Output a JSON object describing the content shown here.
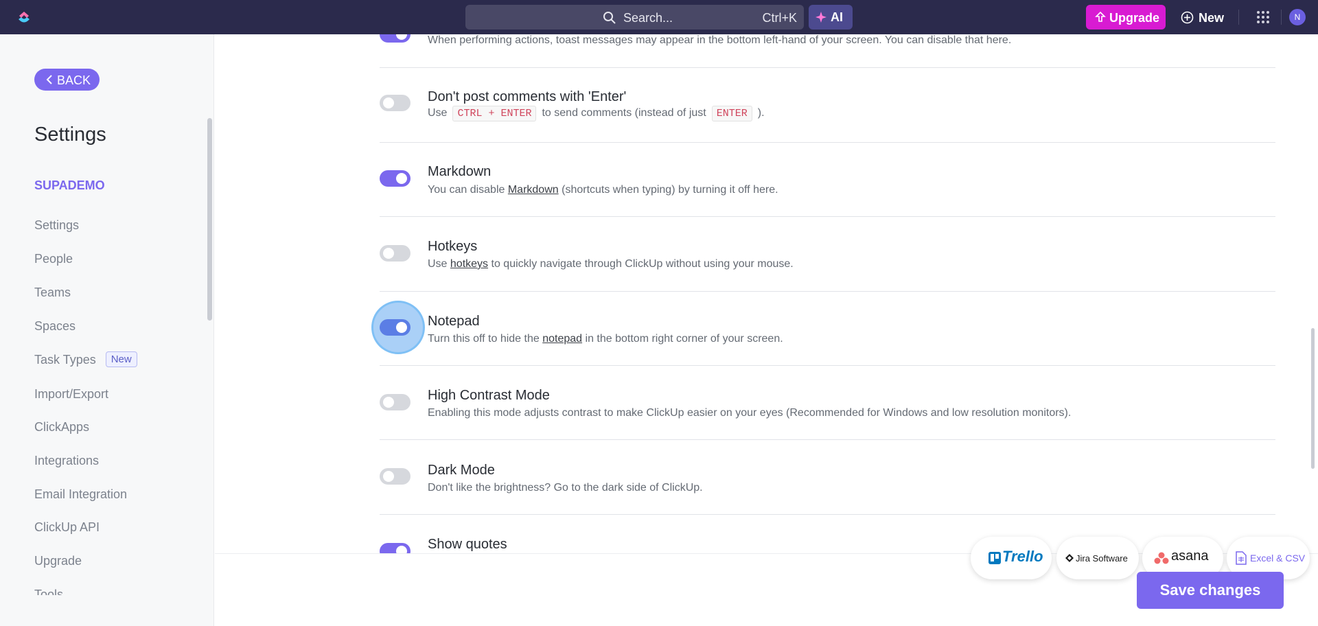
{
  "topbar": {
    "search_placeholder": "Search...",
    "search_shortcut": "Ctrl+K",
    "ai_label": "AI",
    "upgrade_label": "Upgrade",
    "new_label": "New",
    "avatar_initial": "N"
  },
  "sidebar": {
    "back_label": "BACK",
    "title": "Settings",
    "workspace": "SUPADEMO",
    "items": [
      {
        "label": "Settings"
      },
      {
        "label": "People"
      },
      {
        "label": "Teams"
      },
      {
        "label": "Spaces"
      },
      {
        "label": "Task Types",
        "badge": "New"
      },
      {
        "label": "Import/Export"
      },
      {
        "label": "ClickApps"
      },
      {
        "label": "Integrations"
      },
      {
        "label": "Email Integration"
      },
      {
        "label": "ClickUp API"
      },
      {
        "label": "Upgrade"
      },
      {
        "label": "Tools"
      }
    ]
  },
  "settings": {
    "toast": {
      "desc": "When performing actions, toast messages may appear in the bottom left-hand of your screen. You can disable that here.",
      "enabled": true
    },
    "enter_comments": {
      "title": "Don't post comments with 'Enter'",
      "desc_prefix": "Use",
      "kbd1": "CTRL + ENTER",
      "desc_mid": "to send comments (instead of just",
      "kbd2": "ENTER",
      "desc_suffix": ").",
      "enabled": false
    },
    "markdown": {
      "title": "Markdown",
      "desc_prefix": "You can disable",
      "link": "Markdown",
      "desc_suffix": "(shortcuts when typing) by turning it off here.",
      "enabled": true
    },
    "hotkeys": {
      "title": "Hotkeys",
      "desc_prefix": "Use",
      "link": "hotkeys",
      "desc_suffix": "to quickly navigate through ClickUp without using your mouse.",
      "enabled": false
    },
    "notepad": {
      "title": "Notepad",
      "desc_prefix": "Turn this off to hide the",
      "link": "notepad",
      "desc_suffix": "in the bottom right corner of your screen.",
      "enabled": true
    },
    "high_contrast": {
      "title": "High Contrast Mode",
      "desc": "Enabling this mode adjusts contrast to make ClickUp easier on your eyes (Recommended for Windows and low resolution monitors).",
      "enabled": false
    },
    "dark_mode": {
      "title": "Dark Mode",
      "desc": "Don't like the brightness? Go to the dark side of ClickUp.",
      "enabled": false
    },
    "show_quotes": {
      "title": "Show quotes",
      "enabled": true
    }
  },
  "import_chips": {
    "trello": "Trello",
    "jira": "Jira Software",
    "asana": "asana",
    "excel": "Excel & CSV"
  },
  "footer": {
    "save_label": "Save changes"
  },
  "colors": {
    "accent": "#7b68ee",
    "topbar": "#2b2a4c",
    "upgrade": "#d81bd2"
  },
  "icons": [
    "clickup-logo-icon",
    "search-icon",
    "ai-sparkle-icon",
    "upgrade-icon",
    "plus-circle-icon",
    "apps-grid-icon",
    "chevron-left-icon",
    "trello-icon",
    "jira-icon",
    "asana-icon",
    "excel-icon"
  ]
}
